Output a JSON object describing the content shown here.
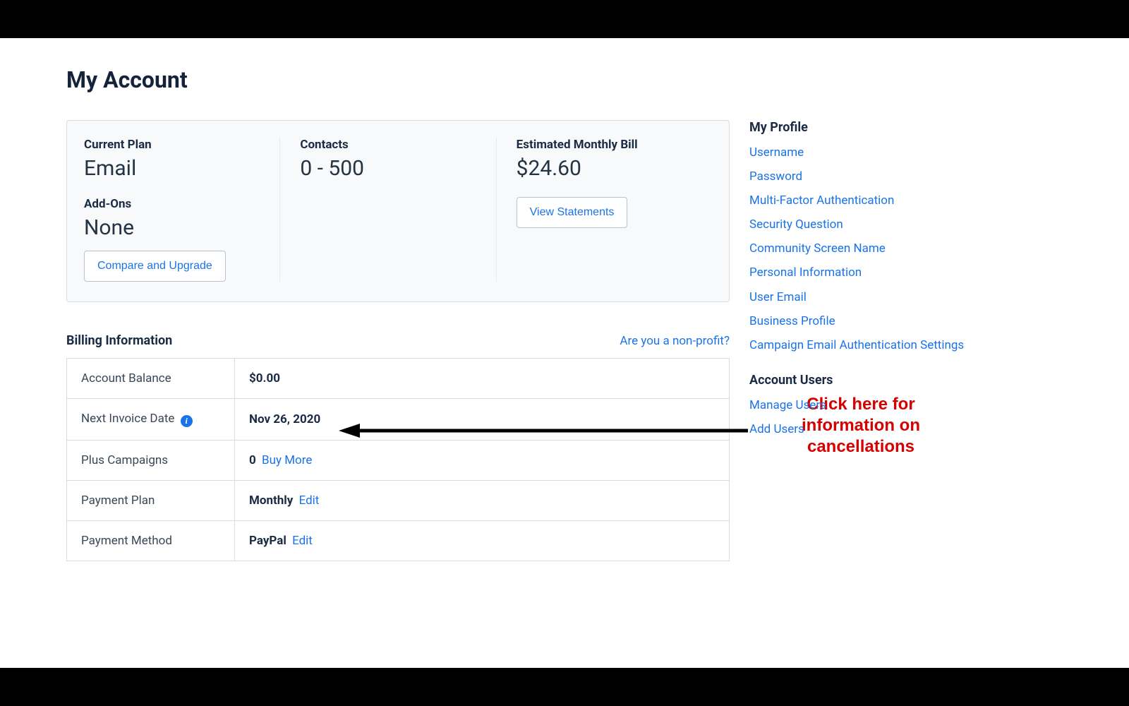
{
  "page": {
    "title": "My Account"
  },
  "summary": {
    "plan_label": "Current Plan",
    "plan_value": "Email",
    "addons_label": "Add-Ons",
    "addons_value": "None",
    "compare_btn": "Compare and Upgrade",
    "contacts_label": "Contacts",
    "contacts_value": "0 - 500",
    "bill_label": "Estimated Monthly Bill",
    "bill_value": "$24.60",
    "view_statements_btn": "View Statements"
  },
  "billing": {
    "heading": "Billing Information",
    "nonprofit_link": "Are you a non-profit?",
    "rows": {
      "balance_label": "Account Balance",
      "balance_value": "$0.00",
      "invoice_label": "Next Invoice Date",
      "invoice_value": "Nov 26, 2020",
      "plus_label": "Plus Campaigns",
      "plus_value": "0",
      "plus_link": "Buy More",
      "plan_label": "Payment Plan",
      "plan_value": "Monthly",
      "plan_link": "Edit",
      "method_label": "Payment Method",
      "method_value": "PayPal",
      "method_link": "Edit"
    }
  },
  "side": {
    "profile_heading": "My Profile",
    "profile_links": {
      "username": "Username",
      "password": "Password",
      "mfa": "Multi-Factor Authentication",
      "security_q": "Security Question",
      "screen_name": "Community Screen Name",
      "personal": "Personal Information",
      "user_email": "User Email",
      "business": "Business Profile",
      "campaign_auth": "Campaign Email Authentication Settings"
    },
    "users_heading": "Account Users",
    "users_links": {
      "manage": "Manage Users",
      "add": "Add Users"
    }
  },
  "annotation": {
    "text": "Click here for information on cancellations"
  }
}
